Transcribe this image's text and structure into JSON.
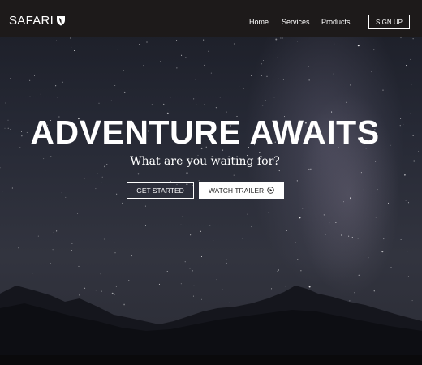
{
  "navbar": {
    "logo_text": "SAFARI",
    "logo_icon": "shield-leaf-icon",
    "links": [
      {
        "label": "Home"
      },
      {
        "label": "Services"
      },
      {
        "label": "Products"
      }
    ],
    "signup_label": "SIGN UP"
  },
  "hero": {
    "headline": "ADVENTURE AWAITS",
    "subheadline": "What are you waiting for?",
    "primary_button": "GET STARTED",
    "secondary_button": "WATCH TRAILER",
    "secondary_button_icon": "play-circle-icon"
  },
  "colors": {
    "nav_background": "#1d1a1a",
    "text": "#ffffff",
    "sky_top": "#1b1d26",
    "sky_bottom": "#32343f",
    "mountains": "#0f1016"
  }
}
